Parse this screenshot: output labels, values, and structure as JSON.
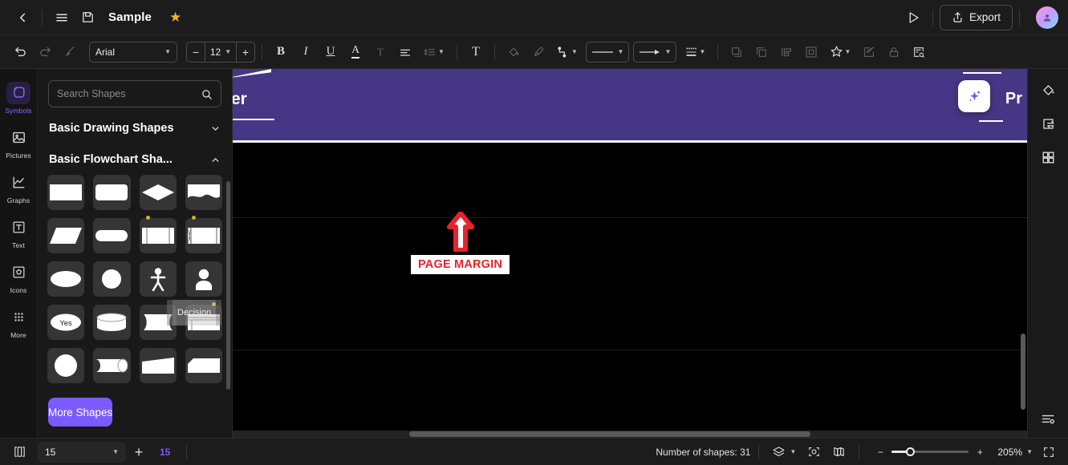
{
  "titlebar": {
    "back_icon": "chevron-left-icon",
    "menu_icon": "hamburger-menu-icon",
    "save_icon": "floppy-save-icon",
    "document_title": "Sample",
    "favorite_icon": "star-icon",
    "present_icon": "play-triangle-icon",
    "export_label": "Export",
    "export_icon": "upload-icon",
    "avatar_icon": "user-avatar"
  },
  "toolbar": {
    "undo_icon": "undo-arrow-icon",
    "redo_icon": "redo-arrow-icon",
    "format_painter_icon": "format-painter-icon",
    "font_family": "Arial",
    "font_size": "12",
    "decrease_size": "−",
    "increase_size": "+",
    "bold_label": "B",
    "italic_label": "I",
    "underline_label": "U",
    "font_color_label": "A",
    "strikethrough_label": "T",
    "align_icon": "text-align-icon",
    "line_spacing_icon": "line-spacing-icon",
    "text_box_label": "T",
    "fill_icon": "paint-bucket-icon",
    "line_color_icon": "brush-icon",
    "connector_icon": "connector-elbow-icon",
    "line_style_icon": "line-style-icon",
    "arrow_style_icon": "arrow-style-icon",
    "line_weight_icon": "line-weight-icon",
    "bring_front_icon": "bring-to-front-icon",
    "send_back_icon": "send-to-back-icon",
    "align_objects_icon": "align-objects-icon",
    "group_icon": "group-objects-icon",
    "effects_icon": "effects-star-icon",
    "edit_icon": "edit-pencil-icon",
    "lock_icon": "lock-icon",
    "find_icon": "find-replace-icon"
  },
  "sidebar": {
    "items": [
      {
        "label": "Symbols",
        "icon": "symbols-icon",
        "active": true
      },
      {
        "label": "Pictures",
        "icon": "pictures-icon",
        "active": false
      },
      {
        "label": "Graphs",
        "icon": "graphs-icon",
        "active": false
      },
      {
        "label": "Text",
        "icon": "text-icon",
        "active": false
      },
      {
        "label": "Icons",
        "icon": "icons-icon",
        "active": false
      },
      {
        "label": "More",
        "icon": "more-grid-icon",
        "active": false
      }
    ]
  },
  "shapes_panel": {
    "search_placeholder": "Search Shapes",
    "search_value": "",
    "search_icon": "search-icon",
    "sections": [
      {
        "title": "Basic Drawing Shapes",
        "expanded": false,
        "chevron": "chevron-down-icon"
      },
      {
        "title": "Basic Flowchart Sha...",
        "expanded": true,
        "chevron": "chevron-up-icon"
      }
    ],
    "shapes": [
      {
        "name": "process-rectangle"
      },
      {
        "name": "rounded-rectangle"
      },
      {
        "name": "decision-diamond"
      },
      {
        "name": "document-wave"
      },
      {
        "name": "data-parallelogram"
      },
      {
        "name": "terminator-stadium"
      },
      {
        "name": "predefined-process"
      },
      {
        "name": "internal-storage"
      },
      {
        "name": "ellipse-connector"
      },
      {
        "name": "circle-connector"
      },
      {
        "name": "actor-person"
      },
      {
        "name": "user-avatar-shape"
      },
      {
        "name": "yes-ellipse",
        "label": "Yes"
      },
      {
        "name": "database-cylinder"
      },
      {
        "name": "document-curve"
      },
      {
        "name": "multi-document"
      },
      {
        "name": "circle-solid"
      },
      {
        "name": "tape-shape"
      },
      {
        "name": "trapezoid-skew"
      },
      {
        "name": "card-shape"
      }
    ],
    "more_shapes_label": "More Shapes",
    "drag_ghost_label": "Decision"
  },
  "canvas": {
    "banner_text_left": "er",
    "banner_text_right": "Pr",
    "banner_color": "#453785",
    "ai_icon": "ai-sparkle-icon",
    "margin_label": "PAGE MARGIN",
    "margin_arrow_icon": "up-arrow-icon",
    "margin_color": "#e8232a"
  },
  "right_rail": {
    "items": [
      {
        "icon": "paint-bucket-icon",
        "name": "fill-tool"
      },
      {
        "icon": "swap-panel-icon",
        "name": "replace-tool"
      },
      {
        "icon": "grid-apps-icon",
        "name": "grid-tool"
      }
    ],
    "settings_icon": "settings-sliders-icon"
  },
  "statusbar": {
    "page_panel_icon": "page-panel-icon",
    "page_value": "15",
    "add_page_icon": "+",
    "current_page": "15",
    "shapes_count_label": "Number of shapes: 31",
    "layers_icon": "layers-icon",
    "focus_icon": "focus-target-icon",
    "map_icon": "map-book-icon",
    "zoom_out": "−",
    "zoom_in": "+",
    "zoom_level": "205%",
    "fullscreen_icon": "fullscreen-icon",
    "accent_color": "#7b5bff"
  }
}
